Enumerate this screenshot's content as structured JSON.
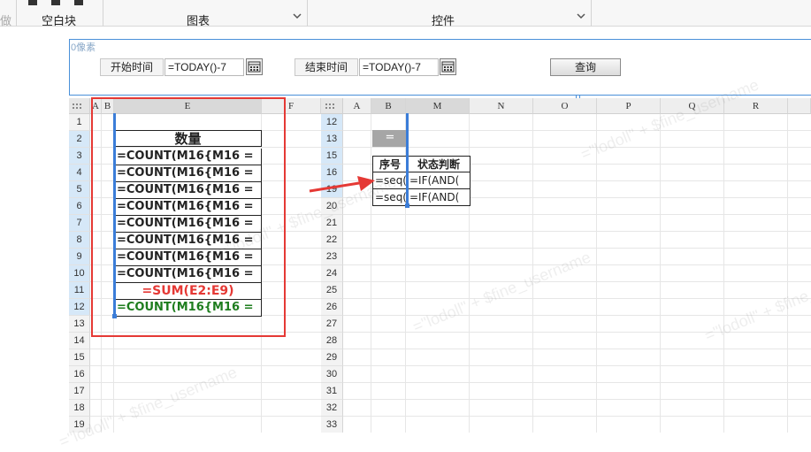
{
  "ribbon": {
    "blank_block_label": "空白块",
    "chart_label": "图表",
    "widget_label": "控件",
    "left_fragment": "做"
  },
  "params": {
    "hint": "0像素",
    "start_label": "开始时间",
    "start_value": "=TODAY()-7",
    "end_label": "结束时间",
    "end_value": "=TODAY()-7",
    "query_button": "查询"
  },
  "left_grid": {
    "columns": [
      "A",
      "B",
      "E",
      "F"
    ],
    "rows": [
      "1",
      "2",
      "3",
      "4",
      "5",
      "6",
      "7",
      "8",
      "9",
      "10",
      "11",
      "12",
      "13",
      "14",
      "15",
      "16",
      "17",
      "18",
      "19"
    ],
    "header_cell": "数量",
    "count_cells": [
      "=COUNT(M16{M16 =",
      "=COUNT(M16{M16 =",
      "=COUNT(M16{M16 =",
      "=COUNT(M16{M16 =",
      "=COUNT(M16{M16 =",
      "=COUNT(M16{M16 =",
      "=COUNT(M16{M16 =",
      "=COUNT(M16{M16 ="
    ],
    "sum_cell": "=SUM(E2:E9)",
    "total_count_cell": "=COUNT(M16{M16 ="
  },
  "right_grid": {
    "columns": [
      "A",
      "B",
      "M",
      "N",
      "O",
      "P",
      "Q",
      "R"
    ],
    "rows": [
      "12",
      "13",
      "15",
      "16",
      "19",
      "20",
      "21",
      "22",
      "23",
      "24",
      "25",
      "26",
      "27",
      "28",
      "29",
      "30",
      "31",
      "32",
      "33"
    ],
    "equals_cell": "=",
    "seq_header": "序号",
    "status_header": "状态判断",
    "seq_cells": [
      "=seq()",
      "=seq()"
    ],
    "status_cells": [
      "=IF(AND(",
      "=IF(AND("
    ]
  },
  "watermark": "=\"lodoll\" + $fine_username",
  "colors": {
    "red_box": "#e53935",
    "selection_blue": "#3b7dd8",
    "sum_text": "#e53935",
    "total_text": "#1e7d1e",
    "merged_gray": "#a6a6a6"
  }
}
